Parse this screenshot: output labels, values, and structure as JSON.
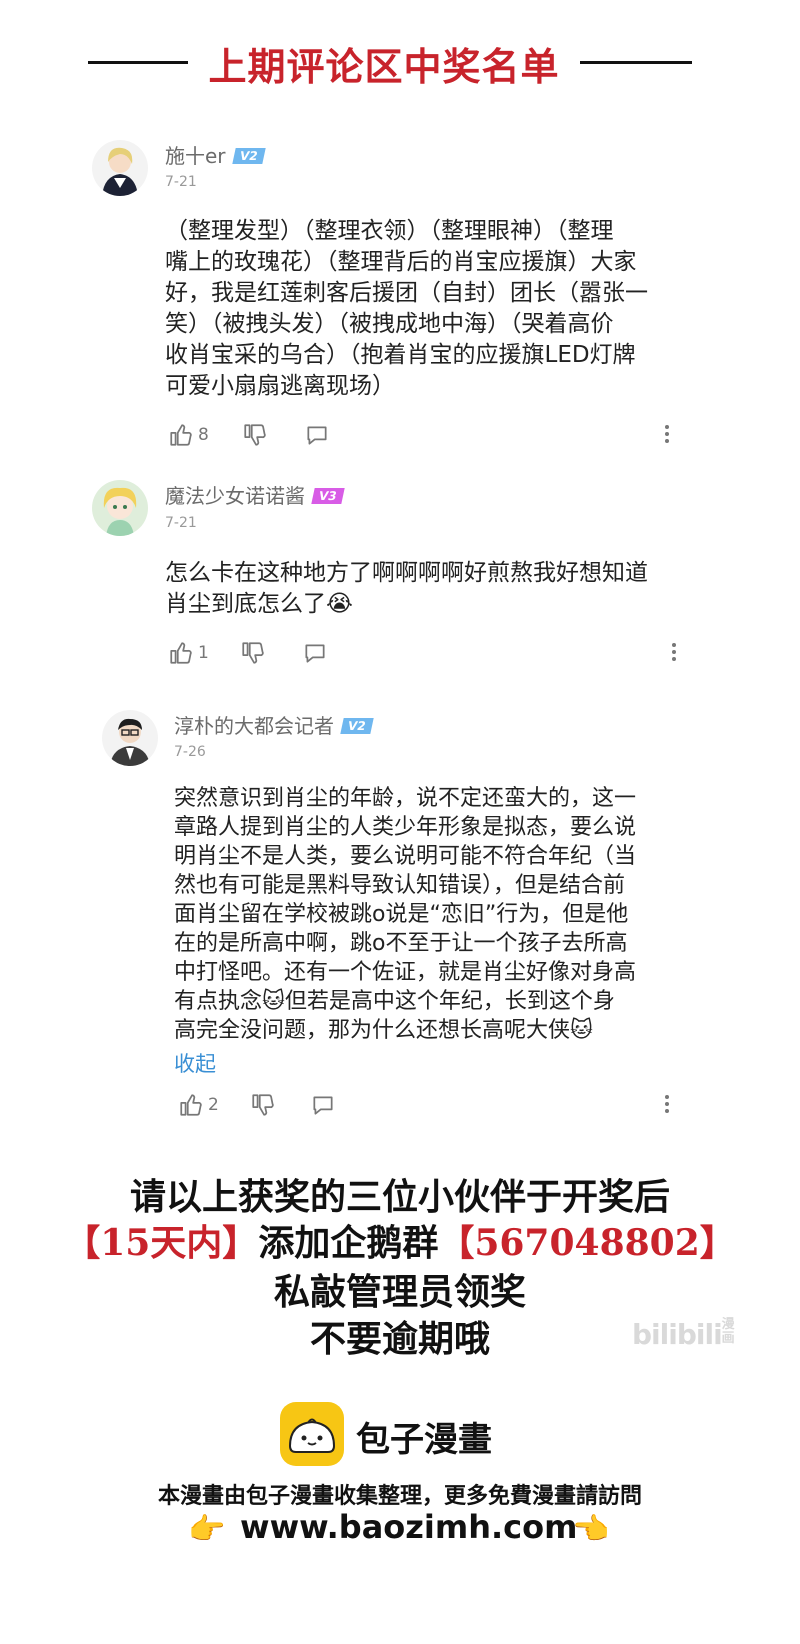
{
  "header": {
    "title": "上期评论区中奖名单"
  },
  "comments": [
    {
      "username": "施十er",
      "level": "V2",
      "date": "7-21",
      "lines": [
        "（整理发型）（整理衣领）（整理眼神）（整理",
        "嘴上的玫瑰花）（整理背后的肖宝应援旗）大家",
        "好，我是红莲刺客后援团（自封）团长（嚣张一",
        "笑）（被拽头发）（被拽成地中海）（哭着高价",
        "收肖宝采的乌合）（抱着肖宝的应援旗LED灯牌",
        "可爱小扇扇逃离现场）"
      ],
      "likes": "8"
    },
    {
      "username": "魔法少女诺诺酱",
      "level": "V3",
      "date": "7-21",
      "lines": [
        "怎么卡在这种地方了啊啊啊啊好煎熬我好想知道",
        "肖尘到底怎么了😭"
      ],
      "likes": "1"
    },
    {
      "username": "淳朴的大都会记者",
      "level": "V2",
      "date": "7-26",
      "lines": [
        "突然意识到肖尘的年龄，说不定还蛮大的，这一",
        "章路人提到肖尘的人类少年形象是拟态，要么说",
        "明肖尘不是人类，要么说明可能不符合年纪（当",
        "然也有可能是黑料导致认知错误），但是结合前",
        "面肖尘留在学校被跳o说是“恋旧”行为，但是他",
        "在的是所高中啊，跳o不至于让一个孩子去所高",
        "中打怪吧。还有一个佐证，就是肖尘好像对身高",
        "有点执念🐱但若是高中这个年纪，长到这个身",
        "高完全没问题，那为什么还想长高呢大侠🐱"
      ],
      "collapse_label": "收起",
      "likes": "2"
    }
  ],
  "notice": {
    "line1": "请以上获奖的三位小伙伴于开奖后",
    "line2_a": "【15天内】",
    "line2_b": "添加企鹅群",
    "line2_c": "【567048802】",
    "line3": "私敲管理员领奖",
    "line4": "不要逾期哦"
  },
  "watermark": {
    "text": "bilibili",
    "tag": "漫画"
  },
  "brand": {
    "name": "包子漫畫"
  },
  "footer": {
    "line1": "本漫畫由包子漫畫收集整理，更多免費漫畫請訪問",
    "url": "www.baozimh.com",
    "hand_left": "👉",
    "hand_right": "👈"
  },
  "colors": {
    "accent_red": "#c8232b",
    "link_blue": "#3a8fd4",
    "v2_badge": "#6fb7ef",
    "v3_badge": "#d85ce6",
    "brand_yellow": "#f7c614"
  }
}
